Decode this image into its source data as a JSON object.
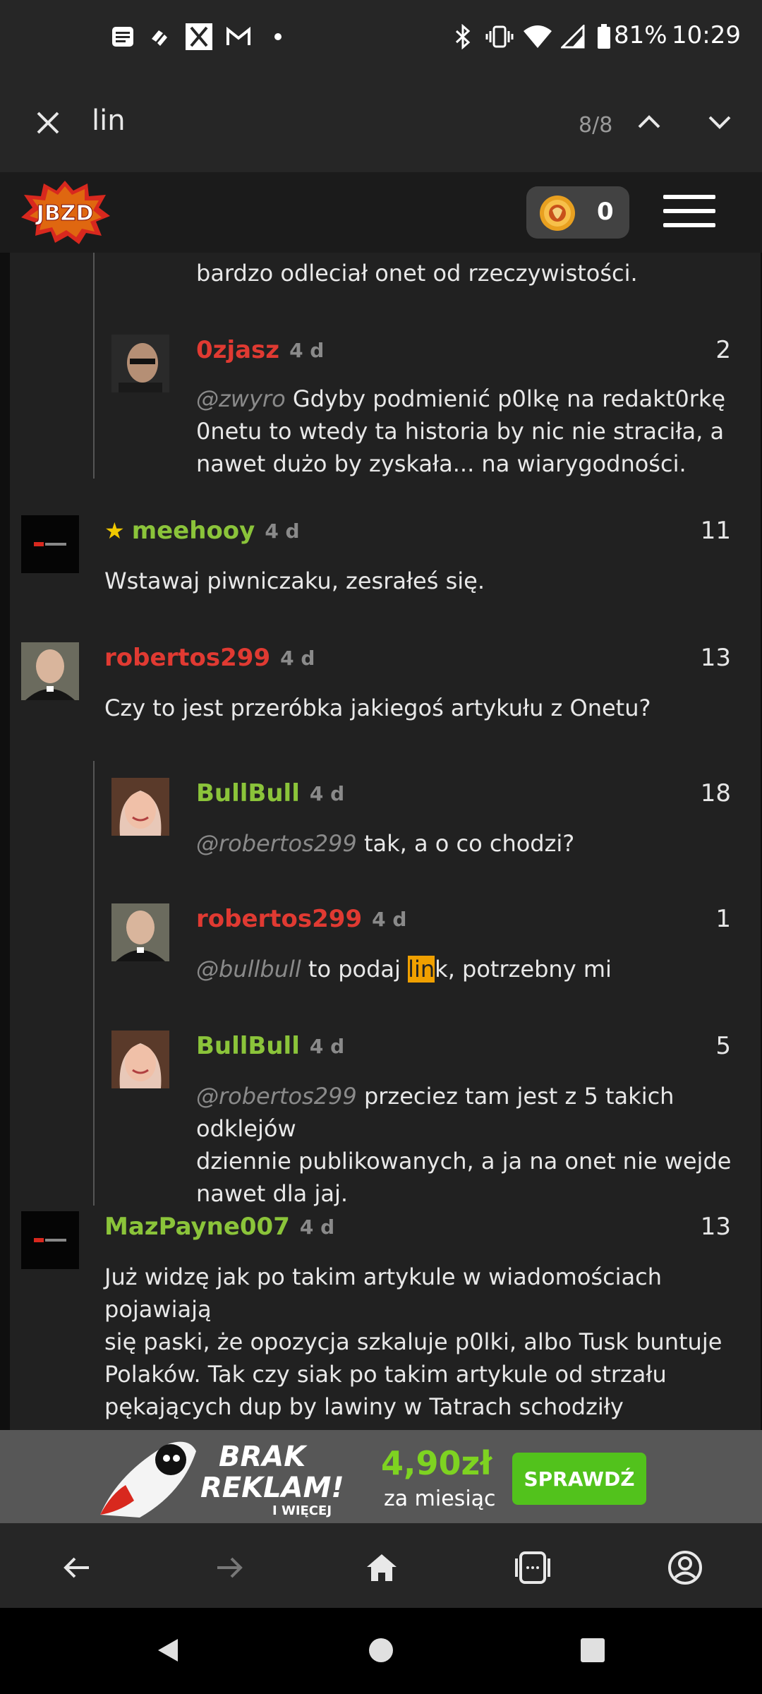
{
  "status_bar": {
    "battery": "81%",
    "time": "10:29"
  },
  "find_bar": {
    "query": "lin",
    "count": "8/8"
  },
  "header": {
    "logo_text": "JBZD",
    "coins": "0"
  },
  "comments": [
    {
      "partial_text": "bardzo odleciał onet od rzeczywistości."
    },
    {
      "username": "0zjasz",
      "ago": "4 d",
      "score": "2",
      "mention": "@zwyro",
      "text_lines": [
        " Gdyby podmienić p0lkę na redakt0rkę",
        "0netu to wtedy ta historia by nic nie straciła, a",
        "nawet dużo by zyskała... na wiarygodności."
      ]
    },
    {
      "username": "meehooy",
      "ago": "4 d",
      "score": "11",
      "text": "Wstawaj piwniczaku, zesrałeś się."
    },
    {
      "username": "robertos299",
      "ago": "4 d",
      "score": "13",
      "text": "Czy to jest przeróbka jakiegoś artykułu z Onetu?"
    },
    {
      "username": "BullBull",
      "ago": "4 d",
      "score": "18",
      "mention": "@robertos299",
      "text": " tak, a o co chodzi?"
    },
    {
      "username": "robertos299",
      "ago": "4 d",
      "score": "1",
      "mention": "@bullbull",
      "text_before": " to podaj ",
      "highlight": "lin",
      "text_after": "k, potrzebny mi"
    },
    {
      "username": "BullBull",
      "ago": "4 d",
      "score": "5",
      "mention": "@robertos299",
      "text_lines": [
        " przeciez tam jest z 5 takich odklejów",
        "dziennie publikowanych, a ja na onet nie wejde",
        "nawet dla jaj."
      ]
    },
    {
      "username": "MazPayne007",
      "ago": "4 d",
      "score": "13",
      "text_lines": [
        "Już widzę jak po takim artykule w wiadomościach pojawiają",
        "się paski, że opozycja szkaluje p0lki, albo Tusk buntuje",
        "Polaków. Tak czy siak po takim artykule od strzału",
        "pękających dup by lawiny w Tatrach schodziły"
      ]
    }
  ],
  "promo": {
    "line1": "BRAK",
    "line2": "REKLAM!",
    "sub": "I WIĘCEJ",
    "price": "4,90zł",
    "per_month": "za miesiąc",
    "button": "SPRAWDŹ"
  },
  "colors": {
    "username_red": "#e03a32",
    "username_green": "#8bc43a",
    "find_highlight": "#f0a000",
    "promo_green": "#7ed321"
  }
}
